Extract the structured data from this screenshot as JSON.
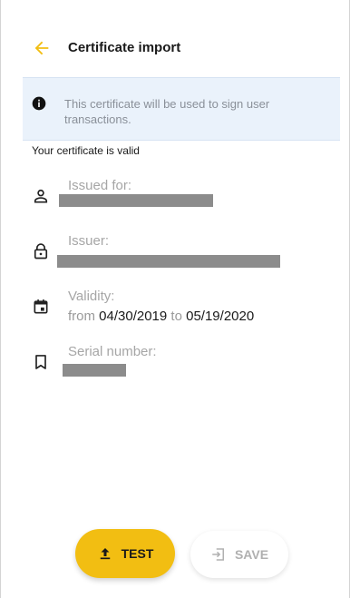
{
  "header": {
    "back_icon": "arrow-left-icon",
    "title": "Certificate import",
    "accent_color": "#f2be12"
  },
  "banner": {
    "icon": "info-icon",
    "text": "This certificate will be used to sign user transactions."
  },
  "status": {
    "text": "Your certificate is valid"
  },
  "fields": {
    "issued_for": {
      "icon": "person-icon",
      "label": "Issued for:"
    },
    "issuer": {
      "icon": "lock-icon",
      "label": "Issuer:"
    },
    "validity": {
      "icon": "calendar-icon",
      "label": "Validity:",
      "from_word": "from",
      "from_date": "04/30/2019",
      "to_word": "to",
      "to_date": "05/19/2020"
    },
    "serial": {
      "icon": "bookmark-icon",
      "label": "Serial number:"
    }
  },
  "actions": {
    "test": {
      "icon": "upload-icon",
      "label": "TEST",
      "color": "#f2be12"
    },
    "save": {
      "icon": "import-icon",
      "label": "SAVE",
      "disabled": true
    }
  }
}
